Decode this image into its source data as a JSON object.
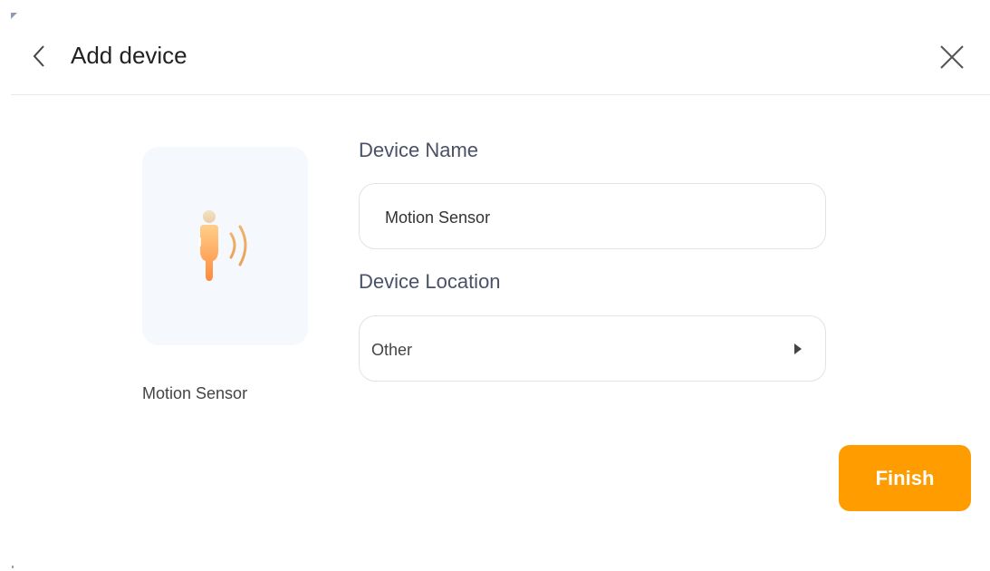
{
  "header": {
    "title": "Add device",
    "back_icon": "chevron-left-icon",
    "close_icon": "close-icon"
  },
  "device": {
    "caption": "Motion Sensor",
    "icon": "motion-sensor-icon"
  },
  "form": {
    "name_label": "Device Name",
    "name_value": "Motion Sensor",
    "location_label": "Device Location",
    "location_value": "Other",
    "location_arrow_icon": "caret-right-icon"
  },
  "actions": {
    "finish_label": "Finish"
  },
  "colors": {
    "accent": "#ff9d00",
    "card_bg": "#f5f8fd",
    "label_text": "#4a5067"
  }
}
